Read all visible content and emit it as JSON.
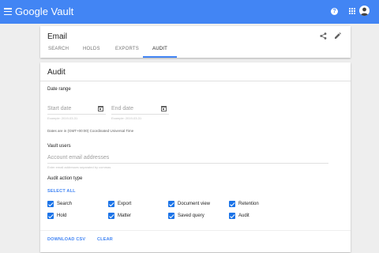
{
  "appbar": {
    "brand": "Google Vault",
    "color": "#4285f4",
    "icons": [
      "menu-icon",
      "help-icon",
      "apps-icon",
      "avatar"
    ]
  },
  "matter": {
    "title": "Email",
    "tabs": [
      {
        "label": "SEARCH"
      },
      {
        "label": "HOLDS"
      },
      {
        "label": "EXPORTS"
      },
      {
        "label": "AUDIT",
        "active": true
      }
    ],
    "icons": [
      "share-icon",
      "edit-icon"
    ]
  },
  "audit": {
    "title": "Audit",
    "date_range": {
      "label": "Date range",
      "start_placeholder": "Start date",
      "start_example": "Example: 2019-03-31",
      "end_placeholder": "End date",
      "end_example": "Example: 2019-03-31",
      "timezone_note": "Dates are in (GMT+00:00) Coordinated Universal Time"
    },
    "vault_users": {
      "label": "Vault users",
      "placeholder": "Account email addresses",
      "hint": "Enter email addresses separated by commas"
    },
    "action_type": {
      "label": "Audit action type",
      "select_all": "SELECT ALL",
      "options": [
        {
          "label": "Search",
          "checked": true
        },
        {
          "label": "Export",
          "checked": true
        },
        {
          "label": "Document view",
          "checked": true
        },
        {
          "label": "Retention",
          "checked": true
        },
        {
          "label": "Hold",
          "checked": true
        },
        {
          "label": "Matter",
          "checked": true
        },
        {
          "label": "Saved query",
          "checked": true
        },
        {
          "label": "Audit",
          "checked": true
        }
      ]
    },
    "actions": {
      "download": "DOWNLOAD CSV",
      "clear": "CLEAR"
    }
  }
}
